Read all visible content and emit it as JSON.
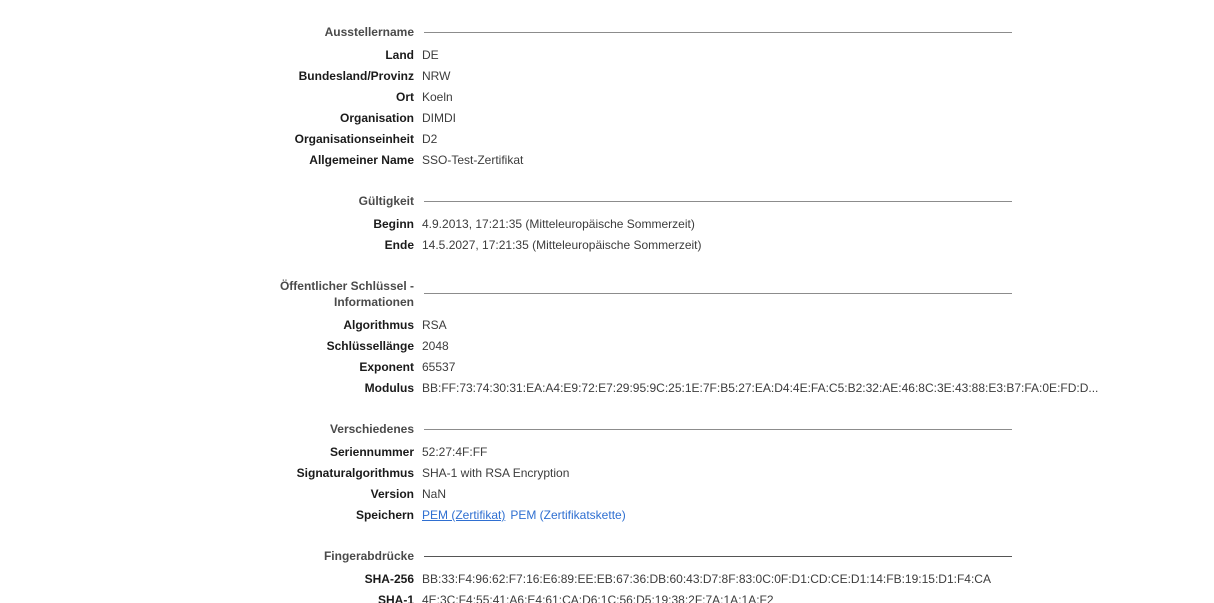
{
  "sections": [
    {
      "title": "Ausstellername",
      "rows": [
        {
          "label": "Land",
          "value": "DE"
        },
        {
          "label": "Bundesland/Provinz",
          "value": "NRW"
        },
        {
          "label": "Ort",
          "value": "Koeln"
        },
        {
          "label": "Organisation",
          "value": "DIMDI"
        },
        {
          "label": "Organisationseinheit",
          "value": "D2"
        },
        {
          "label": "Allgemeiner Name",
          "value": "SSO-Test-Zertifikat"
        }
      ]
    },
    {
      "title": "Gültigkeit",
      "rows": [
        {
          "label": "Beginn",
          "value": "4.9.2013, 17:21:35 (Mitteleuropäische Sommerzeit)"
        },
        {
          "label": "Ende",
          "value": "14.5.2027, 17:21:35 (Mitteleuropäische Sommerzeit)"
        }
      ]
    },
    {
      "title_line1": "Öffentlicher Schlüssel -",
      "title_line2": "Informationen",
      "rows": [
        {
          "label": "Algorithmus",
          "value": "RSA"
        },
        {
          "label": "Schlüssellänge",
          "value": "2048"
        },
        {
          "label": "Exponent",
          "value": "65537"
        },
        {
          "label": "Modulus",
          "value": "BB:FF:73:74:30:31:EA:A4:E9:72:E7:29:95:9C:25:1E:7F:B5:27:EA:D4:4E:FA:C5:B2:32:AE:46:8C:3E:43:88:E3:B7:FA:0E:FD:D..."
        }
      ]
    },
    {
      "title": "Verschiedenes",
      "rows": [
        {
          "label": "Seriennummer",
          "value": "52:27:4F:FF"
        },
        {
          "label": "Signaturalgorithmus",
          "value": "SHA-1 with RSA Encryption"
        },
        {
          "label": "Version",
          "value": "NaN"
        },
        {
          "label": "Speichern",
          "link1": "PEM (Zertifikat)",
          "link2": "PEM (Zertifikatskette)"
        }
      ]
    },
    {
      "title": "Fingerabdrücke",
      "rows": [
        {
          "label": "SHA-256",
          "value": "BB:33:F4:96:62:F7:16:E6:89:EE:EB:67:36:DB:60:43:D7:8F:83:0C:0F:D1:CD:CE:D1:14:FB:19:15:D1:F4:CA"
        },
        {
          "label": "SHA-1",
          "value": "4E:3C:F4:55:41:A6:E4:61:CA:D6:1C:56:D5:19:38:2F:7A:1A:1A:F2"
        }
      ]
    }
  ]
}
